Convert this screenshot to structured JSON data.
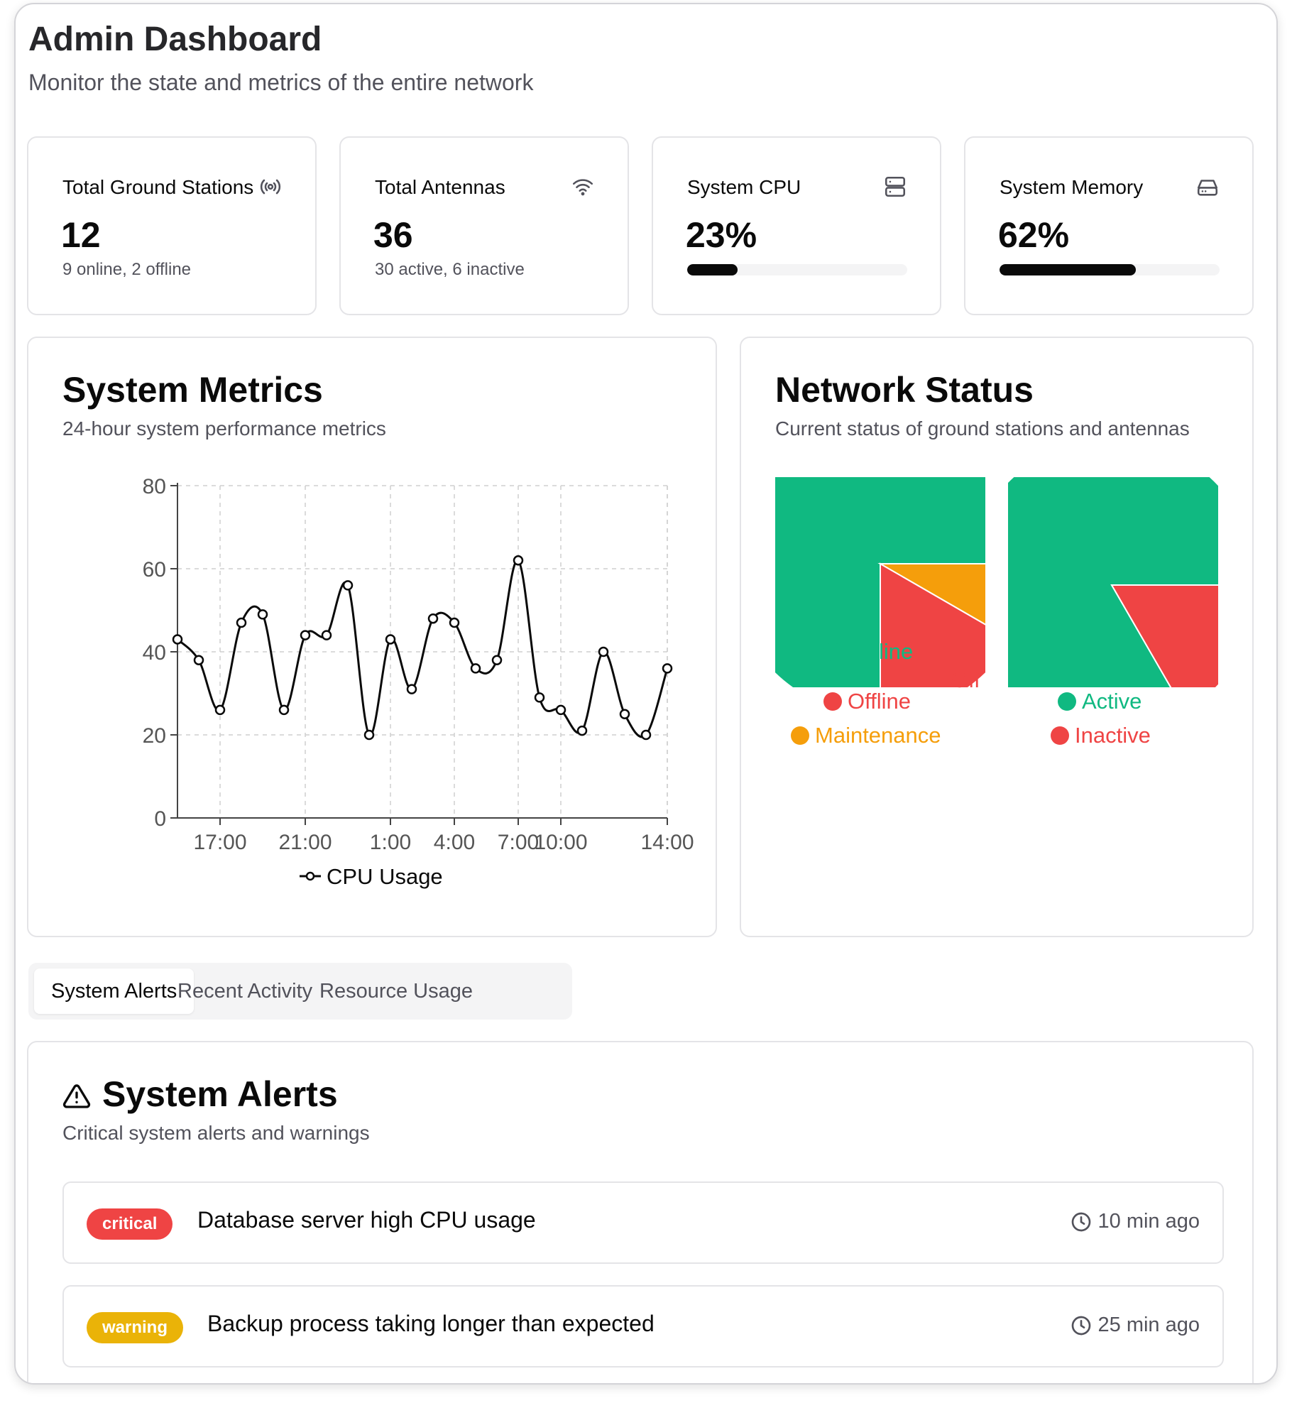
{
  "header": {
    "title": "Admin Dashboard",
    "subtitle": "Monitor the state and metrics of the entire network"
  },
  "stats": {
    "ground_stations": {
      "label": "Total Ground Stations",
      "value": "12",
      "note": "9 online, 2 offline",
      "icon": "radio-icon"
    },
    "antennas": {
      "label": "Total Antennas",
      "value": "36",
      "note": "30 active, 6 inactive",
      "icon": "wifi-icon"
    },
    "cpu": {
      "label": "System CPU",
      "value": "23%",
      "progress": 23,
      "icon": "server-icon"
    },
    "memory": {
      "label": "System Memory",
      "value": "62%",
      "progress": 62,
      "icon": "hard-drive-icon"
    }
  },
  "metrics_panel": {
    "title": "System Metrics",
    "subtitle": "24-hour system performance metrics"
  },
  "network_panel": {
    "title": "Network Status",
    "subtitle": "Current status of ground stations and antennas",
    "stations_overlap_labels": {
      "online_partial": "line",
      "offline_partial": "Off"
    },
    "stations_legend": [
      "Offline",
      "Maintenance"
    ],
    "antennas_legend": [
      "Active",
      "Inactive"
    ]
  },
  "chart_data": [
    {
      "type": "line",
      "x_tick_labels": [
        "17:00",
        "21:00",
        "1:00",
        "4:00",
        "7:00",
        "10:00",
        "14:00"
      ],
      "x_tick_index": [
        2,
        6,
        10,
        13,
        16,
        18,
        23
      ],
      "ylim": [
        0,
        80
      ],
      "yticks": [
        0,
        20,
        40,
        60,
        80
      ],
      "grid": true,
      "legend_position": "bottom",
      "series": [
        {
          "name": "CPU Usage",
          "values": [
            43,
            38,
            26,
            47,
            49,
            26,
            44,
            44,
            56,
            20,
            43,
            31,
            48,
            47,
            36,
            38,
            62,
            29,
            26,
            21,
            40,
            25,
            20,
            36
          ]
        }
      ]
    },
    {
      "type": "pie",
      "categories": [
        "Online",
        "Offline",
        "Maintenance"
      ],
      "values": [
        9,
        2,
        1
      ],
      "colors": [
        "#10b981",
        "#ef4444",
        "#f59e0b"
      ]
    },
    {
      "type": "pie",
      "categories": [
        "Active",
        "Inactive"
      ],
      "values": [
        30,
        6
      ],
      "colors": [
        "#10b981",
        "#ef4444"
      ]
    }
  ],
  "tabs": [
    {
      "label": "System Alerts",
      "active": true
    },
    {
      "label": "Recent Activity",
      "active": false
    },
    {
      "label": "Resource Usage",
      "active": false
    }
  ],
  "alerts_panel": {
    "title": "System Alerts",
    "subtitle": "Critical system alerts and warnings",
    "items": [
      {
        "severity": "critical",
        "message": "Database server high CPU usage",
        "time": "10 min ago",
        "color": "#ef4444"
      },
      {
        "severity": "warning",
        "message": "Backup process taking longer than expected",
        "time": "25 min ago",
        "color": "#eab308"
      }
    ]
  }
}
